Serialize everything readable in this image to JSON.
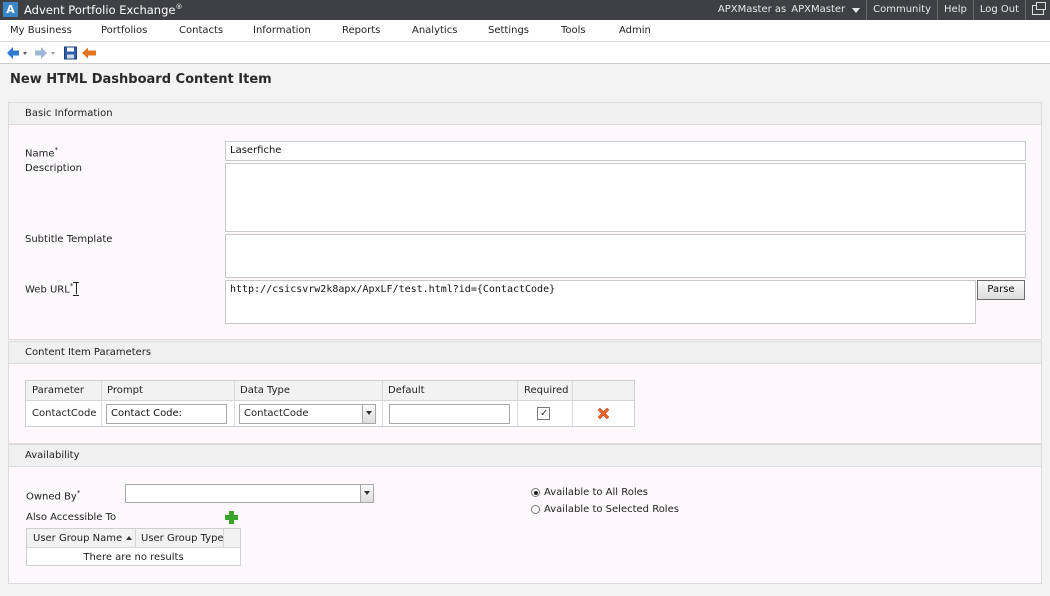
{
  "app": {
    "title": "Advent Portfolio Exchange",
    "title_mark": "®",
    "logo_letter": "A"
  },
  "header_links": {
    "user_prefix": "APXMaster as",
    "user_name": "APXMaster",
    "community": "Community",
    "help": "Help",
    "logout": "Log Out"
  },
  "menu": [
    "My Business",
    "Portfolios",
    "Contacts",
    "Information",
    "Reports",
    "Analytics",
    "Settings",
    "Tools",
    "Admin"
  ],
  "toolbar_icons": [
    "back-arrow-icon",
    "forward-arrow-icon",
    "save-icon",
    "undo-icon"
  ],
  "page": {
    "title": "New HTML Dashboard Content Item"
  },
  "basic_info": {
    "section_title": "Basic Information",
    "name_label": "Name",
    "name_value": "Laserfiche",
    "description_label": "Description",
    "description_value": "",
    "subtitle_label": "Subtitle Template",
    "subtitle_value": "",
    "weburl_label": "Web URL",
    "weburl_value": "http://csicsvrw2k8apx/ApxLF/test.html?id={ContactCode}",
    "parse_label": "Parse",
    "required_mark": "*"
  },
  "params": {
    "section_title": "Content Item Parameters",
    "columns": [
      "Parameter",
      "Prompt",
      "Data Type",
      "Default",
      "Required"
    ],
    "rows": [
      {
        "parameter": "ContactCode",
        "prompt": "Contact Code:",
        "data_type": "ContactCode",
        "default": "",
        "required": true
      }
    ]
  },
  "availability": {
    "section_title": "Availability",
    "owned_by_label": "Owned By",
    "owned_by_value": "",
    "also_accessible_label": "Also Accessible To",
    "radio_all": "Available to All Roles",
    "radio_selected": "Available to Selected Roles",
    "selected_radio": "all",
    "table_columns": [
      "User Group Name",
      "User Group Type"
    ],
    "empty_text": "There are no results"
  },
  "colors": {
    "titlebar_bg": "#3f4044",
    "logo_bg": "#3a86c8",
    "nav_arrow": "#2f7bd0",
    "undo_arrow": "#e07420",
    "delete_x": "#e8622a",
    "add_plus": "#3aa52a"
  }
}
